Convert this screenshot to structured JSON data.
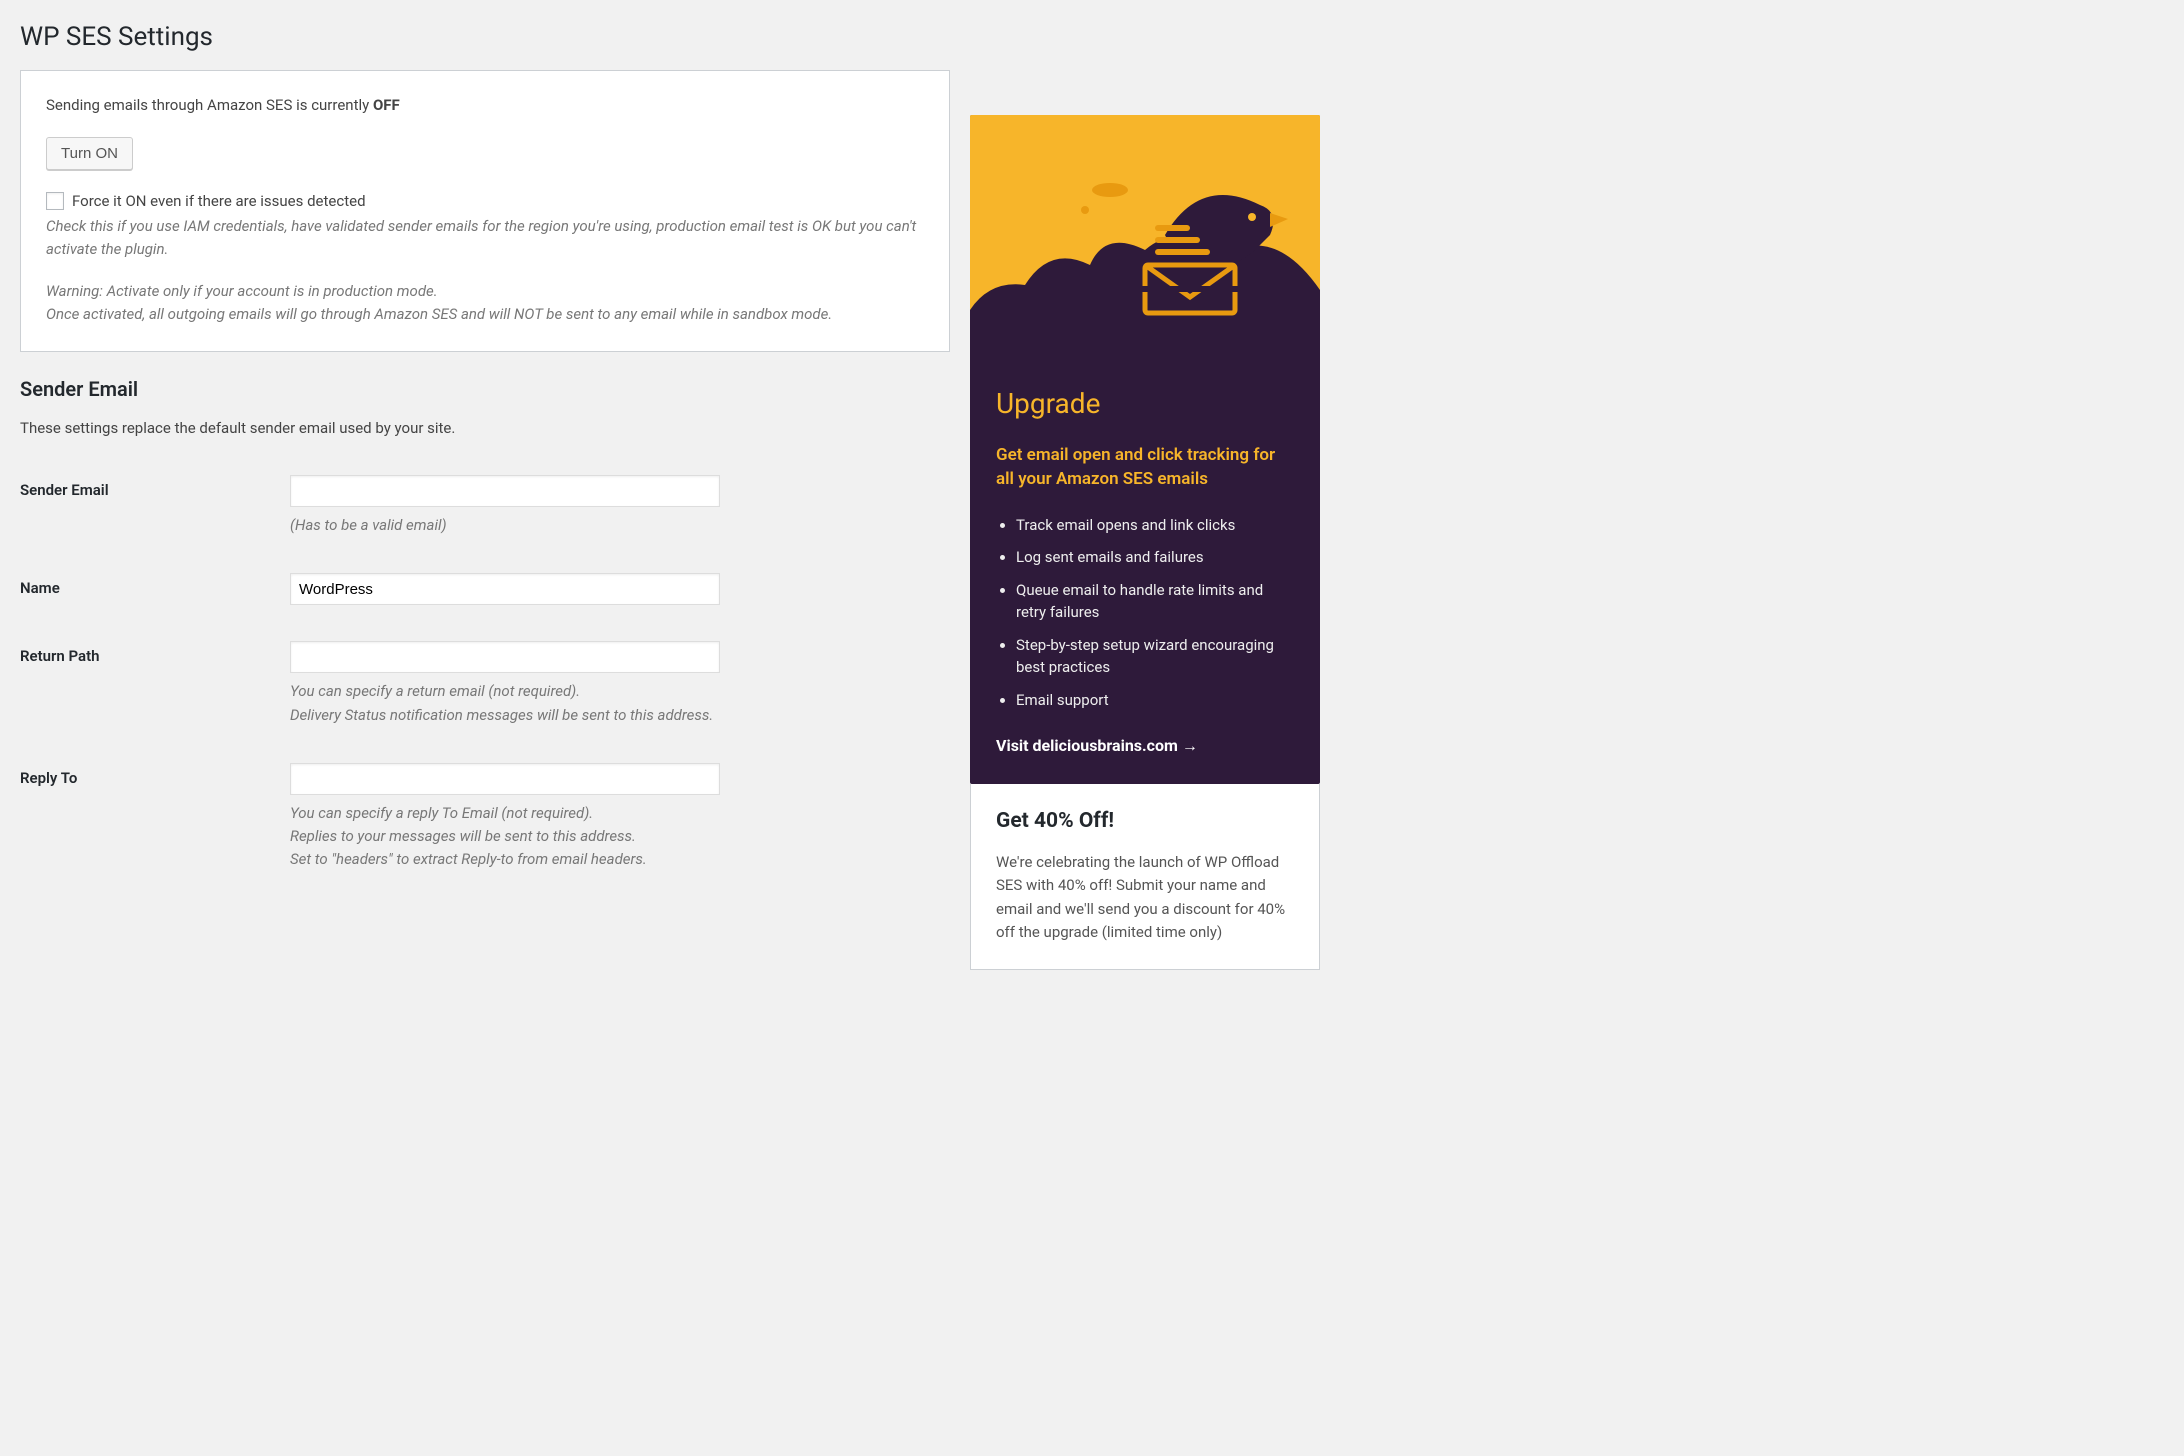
{
  "page_title": "WP SES Settings",
  "status": {
    "prefix": "Sending emails through Amazon SES is currently ",
    "state": "OFF",
    "button_label": "Turn ON",
    "force_checkbox_label": "Force it ON even if there are issues detected",
    "force_help": "Check this if you use IAM credentials, have validated sender emails for the region you're using, production email test is OK but you can't activate the plugin.",
    "warning": "Warning: Activate only if your account is in production mode.\nOnce activated, all outgoing emails will go through Amazon SES and will NOT be sent to any email while in sandbox mode."
  },
  "sender_section": {
    "heading": "Sender Email",
    "description": "These settings replace the default sender email used by your site.",
    "fields": {
      "sender_email": {
        "label": "Sender Email",
        "value": "",
        "help": "(Has to be a valid email)"
      },
      "name": {
        "label": "Name",
        "value": "WordPress",
        "help": ""
      },
      "return_path": {
        "label": "Return Path",
        "value": "",
        "help": "You can specify a return email (not required).\nDelivery Status notification messages will be sent to this address."
      },
      "reply_to": {
        "label": "Reply To",
        "value": "",
        "help": "You can specify a reply To Email (not required).\nReplies to your messages will be sent to this address.\nSet to \"headers\" to extract Reply-to from email headers."
      }
    }
  },
  "upgrade": {
    "title": "Upgrade",
    "subtitle": "Get email open and click tracking for all your Amazon SES emails",
    "features": [
      "Track email opens and link clicks",
      "Log sent emails and failures",
      "Queue email to handle rate limits and retry failures",
      "Step-by-step setup wizard encouraging best practices",
      "Email support"
    ],
    "link_text": "Visit deliciousbrains.com →"
  },
  "promo": {
    "title": "Get 40% Off!",
    "body": "We're celebrating the launch of WP Offload SES with 40% off! Submit your name and email and we'll send you a discount for 40% off the upgrade (limited time only)"
  }
}
